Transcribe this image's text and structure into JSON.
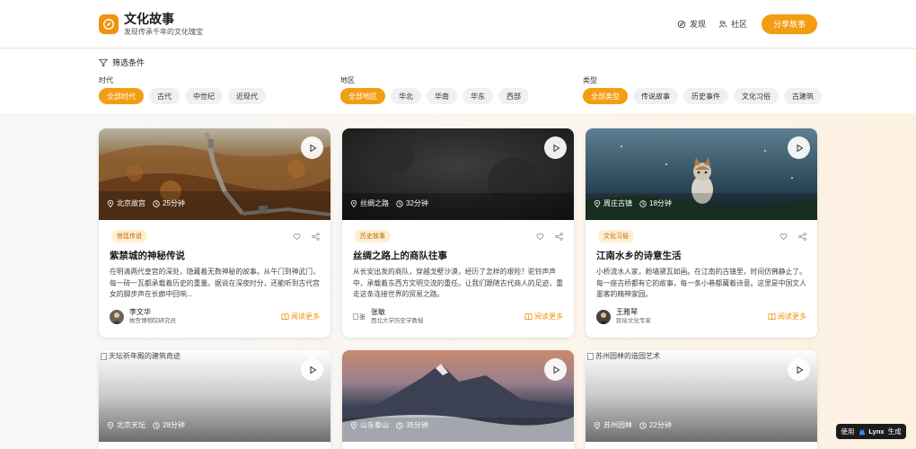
{
  "brand": {
    "title": "文化故事",
    "subtitle": "发现传承千年的文化瑰宝"
  },
  "nav": {
    "discover": "发现",
    "community": "社区",
    "share": "分享故事"
  },
  "filters": {
    "heading": "筛选条件",
    "groups": [
      {
        "label": "时代",
        "options": [
          "全部时代",
          "古代",
          "中世纪",
          "近现代"
        ],
        "selected": "全部时代"
      },
      {
        "label": "地区",
        "options": [
          "全部地区",
          "华北",
          "华南",
          "华东",
          "西部"
        ],
        "selected": "全部地区"
      },
      {
        "label": "类型",
        "options": [
          "全部类型",
          "传说故事",
          "历史事件",
          "文化习俗",
          "古建筑"
        ],
        "selected": "全部类型"
      }
    ]
  },
  "cards": [
    {
      "location": "北京故宫",
      "duration": "25分钟",
      "tag": "宫廷传说",
      "title": "紫禁城的神秘传说",
      "desc": "在明清两代皇宫的深处，隐藏着无数神秘的故事。从午门到神武门，每一砖一瓦都承载着历史的重量。据说在深夜时分，还能听到古代宫女的脚步声在长廊中回响...",
      "author": "李文华",
      "role": "故宫博物院研究员",
      "read_more": "阅读更多"
    },
    {
      "location": "丝绸之路",
      "duration": "32分钟",
      "tag": "历史故事",
      "title": "丝绸之路上的商队往事",
      "desc": "从长安出发的商队，穿越戈壁沙漠，经历了怎样的艰险？驼铃声声中，承载着东西方文明交流的重任。让我们跟随古代商人的足迹，重走这条连接世界的贸易之路。",
      "author": "张敏",
      "author_alt": "张",
      "role": "西北大学历史学教授",
      "read_more": "阅读更多"
    },
    {
      "location": "周庄古镇",
      "duration": "18分钟",
      "tag": "文化习俗",
      "title": "江南水乡的诗意生活",
      "desc": "小桥流水人家，粉墙黛瓦如画。在江南的古镇里，时间仿佛静止了。每一座古桥都有它的故事，每一条小巷都藏着诗意。这里是中国文人墨客的精神家园。",
      "author": "王雅琴",
      "role": "民俗文化专家",
      "read_more": "阅读更多"
    },
    {
      "location": "北京天坛",
      "duration": "28分钟",
      "img_alt": "天坛祈年殿的建筑奇迹"
    },
    {
      "location": "山东泰山",
      "duration": "35分钟"
    },
    {
      "location": "苏州园林",
      "duration": "22分钟",
      "img_alt": "苏州园林的造园艺术"
    }
  ],
  "badge": {
    "prefix": "使用",
    "name": "Lynx",
    "suffix": "生成"
  },
  "colors": {
    "accent": "#f39d12",
    "tag_bg": "#fdefcf",
    "tag_text": "#b8650a"
  }
}
